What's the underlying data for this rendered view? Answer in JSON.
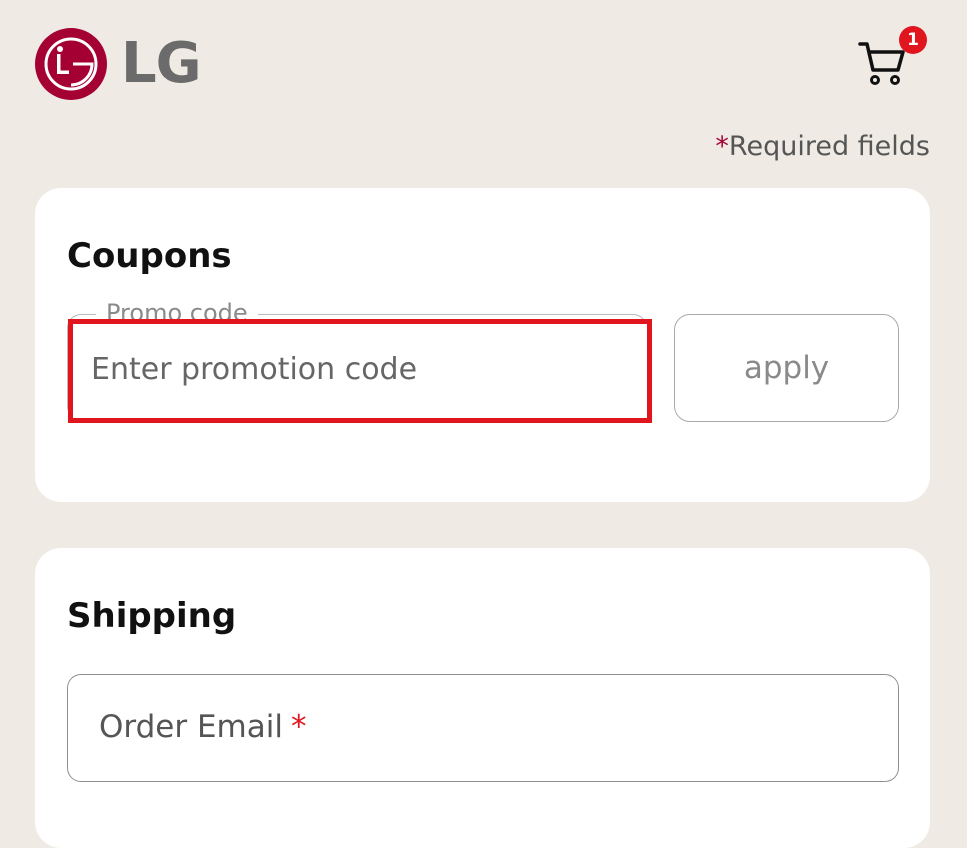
{
  "brand": {
    "name": "LG",
    "color": "#a50034"
  },
  "cart": {
    "count": "1",
    "badge_color": "#e0151d",
    "icon": "cart-icon"
  },
  "required_note": {
    "star": "*",
    "text": "Required fields"
  },
  "coupons": {
    "title": "Coupons",
    "promo_label": "Promo code",
    "promo_placeholder": "Enter promotion code",
    "promo_value": "",
    "apply_label": "apply"
  },
  "shipping": {
    "title": "Shipping",
    "email_label": "Order Email",
    "email_required": "*"
  },
  "colors": {
    "background": "#efebe4",
    "accent_red": "#e0151d"
  }
}
